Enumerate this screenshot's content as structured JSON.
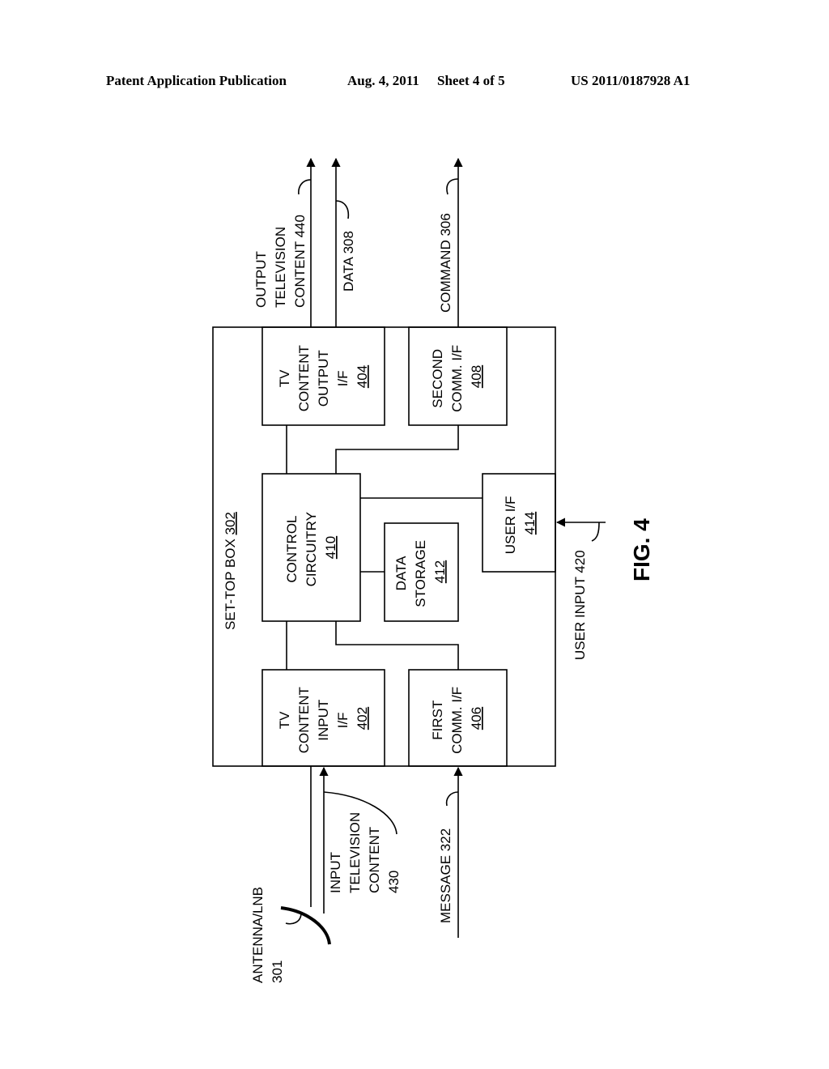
{
  "header": {
    "publication": "Patent Application Publication",
    "date": "Aug. 4, 2011",
    "sheet": "Sheet 4 of 5",
    "number": "US 2011/0187928 A1"
  },
  "figure": {
    "caption": "FIG. 4",
    "container": {
      "label": "SET-TOP BOX",
      "ref": "302"
    },
    "blocks": {
      "tv_output": {
        "lines": [
          "TV",
          "CONTENT",
          "OUTPUT",
          "I/F"
        ],
        "ref": "404"
      },
      "second_comm": {
        "lines": [
          "SECOND",
          "COMM. I/F"
        ],
        "ref": "408"
      },
      "control": {
        "lines": [
          "CONTROL",
          "CIRCUITRY"
        ],
        "ref": "410"
      },
      "data_storage": {
        "lines": [
          "DATA",
          "STORAGE"
        ],
        "ref": "412"
      },
      "user_if": {
        "lines": [
          "USER I/F"
        ],
        "ref": "414"
      },
      "tv_input": {
        "lines": [
          "TV",
          "CONTENT",
          "INPUT",
          "I/F"
        ],
        "ref": "402"
      },
      "first_comm": {
        "lines": [
          "FIRST",
          "COMM. I/F"
        ],
        "ref": "406"
      }
    },
    "signals": {
      "output_tv": [
        "OUTPUT",
        "TELEVISION",
        "CONTENT 440"
      ],
      "data": "DATA 308",
      "command": "COMMAND 306",
      "user_input": "USER INPUT 420",
      "input_tv": [
        "INPUT",
        "TELEVISION",
        "CONTENT",
        "430"
      ],
      "message": "MESSAGE 322",
      "antenna": [
        "ANTENNA/LNB",
        "301"
      ]
    }
  }
}
